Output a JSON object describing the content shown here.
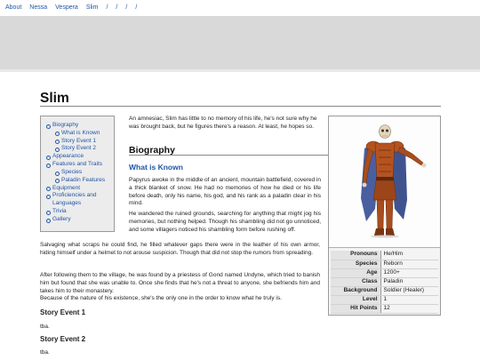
{
  "nav": {
    "items": [
      "About",
      "Nessa",
      "Vespera",
      "Slim",
      "/",
      "/",
      "/",
      "/"
    ]
  },
  "page": {
    "title": "Slim"
  },
  "toc": {
    "items": [
      {
        "label": "Biography",
        "level": 1
      },
      {
        "label": "What is Known",
        "level": 2
      },
      {
        "label": "Story Event 1",
        "level": 2
      },
      {
        "label": "Story Event 2",
        "level": 2
      },
      {
        "label": "Appearance",
        "level": 1
      },
      {
        "label": "Features and Traits",
        "level": 1
      },
      {
        "label": "Species",
        "level": 2
      },
      {
        "label": "Paladin Features",
        "level": 2
      },
      {
        "label": "Equipment",
        "level": 1
      },
      {
        "label": "Proficiencies and Languages",
        "level": 1
      },
      {
        "label": "Trivia",
        "level": 1
      },
      {
        "label": "Gallery",
        "level": 1
      }
    ]
  },
  "content": {
    "intro": "An amnesiac, Slim has little to no memory of his life, he's not sure why he was brought back, but he figures there's a reason. At least, he hopes so.",
    "biography_heading": "Biography",
    "known_heading": "What is Known",
    "paragraphs": [
      "Papyrus awoke in the middle of an ancient, mountain battlefield, covered in a thick blanket of snow. He had no memories of how he died or his life before death, only his name, his god, and his rank as a paladin clear in his mind.",
      "He wandered the ruined grounds, searching for anything that might jog his memories, but nothing helped. Though his shambling did not go unnoticed, and some villagers noticed his shambling form before rushing off.",
      "Salvaging what scraps he could find, he filled whatever gaps there were in the leather of his own armor, hiding himself under a helmet to not arouse suspicion. Though that did not stop the rumors from spreading.",
      "After following them to the village, he was found by a priestess of Gond named Undyne, which tried to banish him but found that she was unable to. Once she finds that he's not a threat to anyone, she befriends him and takes him to their monastery.",
      "Because of the nature of his existence, she's the only one in the order to know what he truly is."
    ],
    "event1_heading": "Story Event 1",
    "event1_text": "tba.",
    "event2_heading": "Story Event 2",
    "event2_text": "tba."
  },
  "infobox": {
    "rows": [
      {
        "label": "Pronouns",
        "value": "He/Him"
      },
      {
        "label": "Species",
        "value": "Reborn"
      },
      {
        "label": "Age",
        "value": "1200+"
      },
      {
        "label": "Class",
        "value": "Paladin"
      },
      {
        "label": "Background",
        "value": "Soldier (Healer)"
      },
      {
        "label": "Level",
        "value": "1"
      },
      {
        "label": "Hit Points",
        "value": "12"
      }
    ]
  },
  "colors": {
    "link": "#1f55a6",
    "banner": "#d9d9d9",
    "armor": "#b5531f",
    "cloak": "#4a5fa0"
  }
}
